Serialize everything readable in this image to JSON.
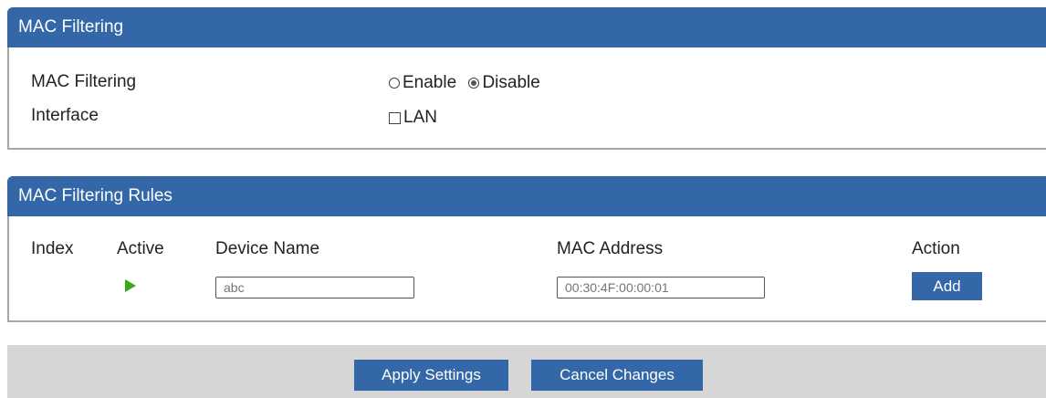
{
  "mac_filtering": {
    "title": "MAC Filtering",
    "mac_filtering_label": "MAC Filtering",
    "enable_label": "Enable",
    "disable_label": "Disable",
    "selected": "Disable",
    "interface_label": "Interface",
    "lan_label": "LAN",
    "lan_checked": false
  },
  "rules": {
    "title": "MAC Filtering Rules",
    "columns": [
      "Index",
      "Active",
      "Device Name",
      "MAC Address",
      "Action"
    ],
    "device_name_placeholder": "abc",
    "mac_address_placeholder": "00:30:4F:00:00:01",
    "add_label": "Add"
  },
  "footer": {
    "apply_label": "Apply Settings",
    "cancel_label": "Cancel Changes"
  },
  "colors": {
    "header": "#3367a8",
    "active_icon": "#3aa61b",
    "footer_bg": "#d6d6d6"
  }
}
